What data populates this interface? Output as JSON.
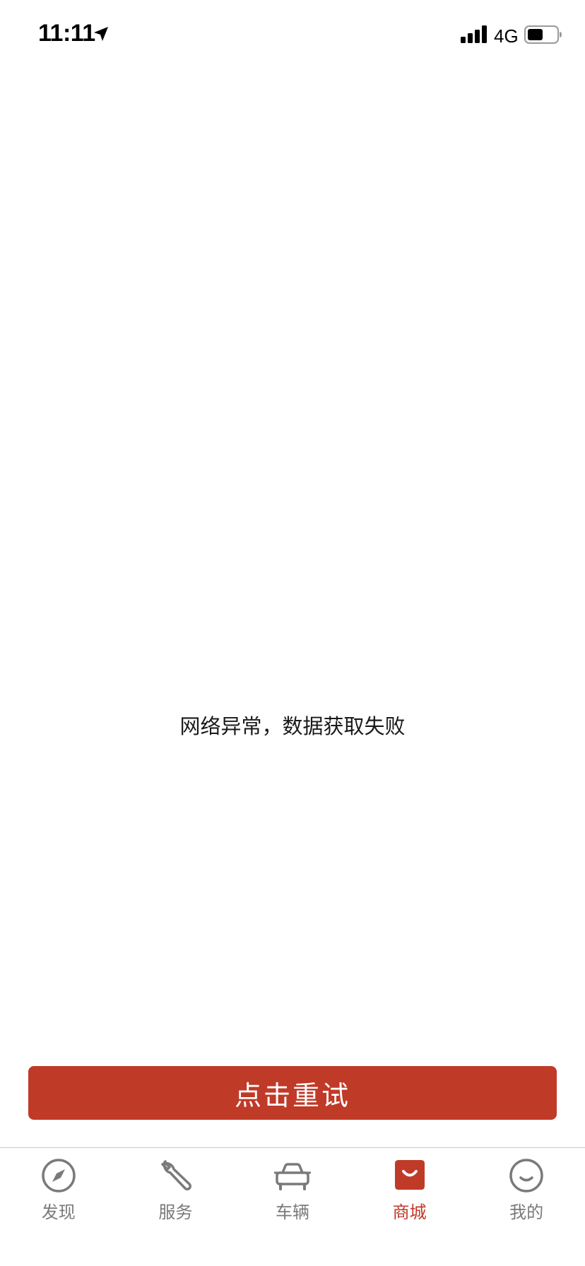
{
  "status_bar": {
    "time": "11:11",
    "network_type": "4G",
    "location_icon": "location-arrow-icon",
    "signal_icon": "cellular-signal-icon",
    "battery_icon": "battery-icon"
  },
  "main": {
    "error_message": "网络异常，数据获取失败",
    "retry_label": "点击重试"
  },
  "tab_bar": {
    "active_index": 3,
    "items": [
      {
        "label": "发现",
        "icon": "compass-icon"
      },
      {
        "label": "服务",
        "icon": "wrench-icon"
      },
      {
        "label": "车辆",
        "icon": "car-icon"
      },
      {
        "label": "商城",
        "icon": "shopping-bag-icon"
      },
      {
        "label": "我的",
        "icon": "smiley-face-icon"
      }
    ]
  },
  "colors": {
    "accent": "#c03a28",
    "tab_inactive": "#7a7a7a",
    "text": "#1a1a1a",
    "background": "#ffffff"
  }
}
